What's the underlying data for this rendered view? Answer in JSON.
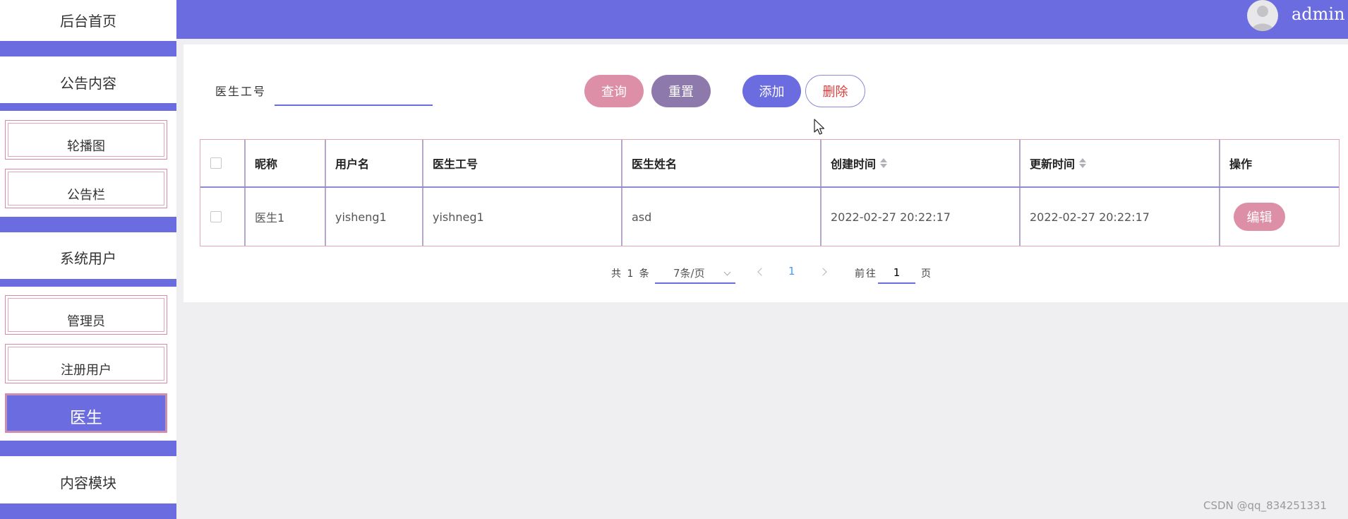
{
  "sidebar": {
    "home": "后台首页",
    "notice_group": "公告内容",
    "carousel": "轮播图",
    "bulletin": "公告栏",
    "users_group": "系统用户",
    "admin": "管理员",
    "registered": "注册用户",
    "doctor": "医生",
    "content_group": "内容模块"
  },
  "header": {
    "username": "admin"
  },
  "search": {
    "label": "医生工号",
    "value": ""
  },
  "buttons": {
    "query": "查询",
    "reset": "重置",
    "add": "添加",
    "delete": "删除"
  },
  "table": {
    "columns": [
      "昵称",
      "用户名",
      "医生工号",
      "医生姓名",
      "创建时间",
      "更新时间",
      "操作"
    ],
    "rows": [
      {
        "nickname": "医生1",
        "username": "yisheng1",
        "doctor_id": "yishneg1",
        "doctor_name": "asd",
        "created": "2022-02-27 20:22:17",
        "updated": "2022-02-27 20:22:17",
        "action": "编辑"
      }
    ]
  },
  "pagination": {
    "total": "共 1 条",
    "page_size": "7条/页",
    "current": "1",
    "goto_label": "前往",
    "goto_value": "1",
    "page_suffix": "页"
  },
  "watermark": "CSDN @qq_834251331",
  "colors": {
    "primary": "#6b6ce0",
    "pink": "#dc8fa7",
    "purple": "#8e79ad",
    "danger": "#e03a3a"
  }
}
